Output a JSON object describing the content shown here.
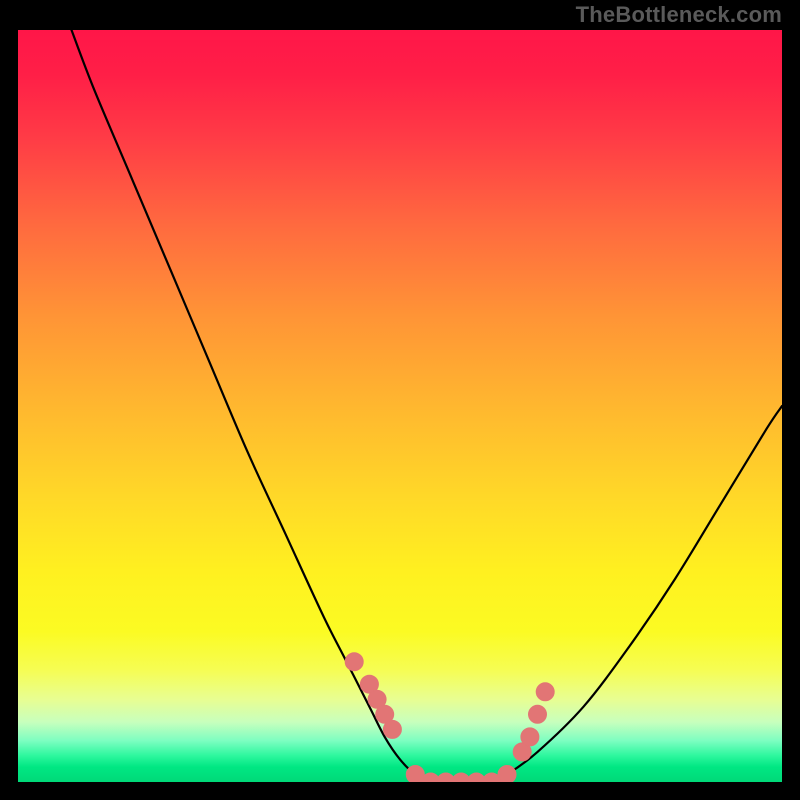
{
  "watermark": "TheBottleneck.com",
  "colors": {
    "gradient_top": "#ff1648",
    "gradient_mid": "#ffd828",
    "gradient_bottom": "#00d978",
    "curve": "#000000",
    "dots": "#e27575",
    "background": "#000000"
  },
  "chart_data": {
    "type": "line",
    "title": "",
    "xlabel": "",
    "ylabel": "",
    "xlim": [
      0,
      100
    ],
    "ylim": [
      0,
      100
    ],
    "series": [
      {
        "name": "bottleneck-curve",
        "x": [
          7,
          10,
          15,
          20,
          25,
          30,
          35,
          40,
          43,
          46,
          48,
          50,
          52,
          54,
          56,
          58,
          60,
          62,
          64,
          68,
          74,
          80,
          86,
          92,
          98,
          100
        ],
        "y": [
          100,
          92,
          80,
          68,
          56,
          44,
          33,
          22,
          16,
          10,
          6,
          3,
          1,
          0,
          0,
          0,
          0,
          0,
          1,
          4,
          10,
          18,
          27,
          37,
          47,
          50
        ]
      }
    ],
    "dots": {
      "name": "highlight-dots",
      "x": [
        44,
        46,
        47,
        48,
        49,
        52,
        54,
        56,
        58,
        60,
        62,
        64,
        66,
        67,
        68,
        69
      ],
      "y": [
        16,
        13,
        11,
        9,
        7,
        1,
        0,
        0,
        0,
        0,
        0,
        1,
        4,
        6,
        9,
        12
      ]
    }
  }
}
